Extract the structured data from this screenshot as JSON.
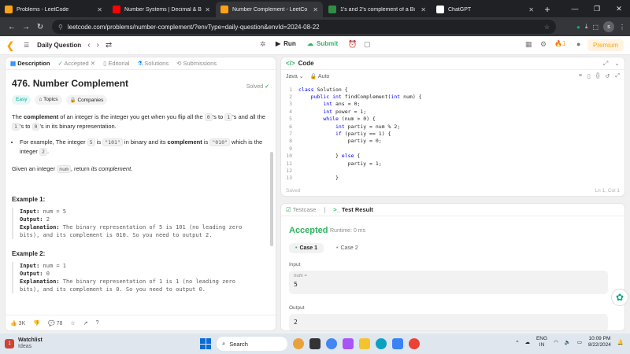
{
  "browser": {
    "tabs": [
      {
        "title": "Problems - LeetCode",
        "color": "#ffa116"
      },
      {
        "title": "Number Systems | Decimal & B",
        "color": "#ff0000"
      },
      {
        "title": "Number Complement - LeetCo",
        "color": "#ffa116",
        "active": true
      },
      {
        "title": "1's and 2's complement of a Bi",
        "color": "#2f8d46"
      },
      {
        "title": "ChatGPT",
        "color": "#ffffff"
      }
    ],
    "url": "leetcode.com/problems/number-complement/?envType=daily-question&envId=2024-08-22",
    "profile_initial": "s"
  },
  "lc_header": {
    "daily_question": "Daily Question",
    "run": "Run",
    "submit": "Submit",
    "streak": "1",
    "premium": "Premium"
  },
  "problem": {
    "tabs": {
      "description": "Description",
      "accepted": "Accepted",
      "editorial": "Editorial",
      "solutions": "Solutions",
      "submissions": "Submissions"
    },
    "title": "476. Number Complement",
    "status": "Solved",
    "difficulty": "Easy",
    "topics": "Topics",
    "companies": "Companies",
    "p1_a": "The ",
    "p1_b": "complement",
    "p1_c": " of an integer is the integer you get when you flip all the ",
    "p1_d": "0",
    "p1_e": "'s to ",
    "p1_f": "1",
    "p1_g": "'s and all the ",
    "p1_h": "1",
    "p1_i": "'s to ",
    "p1_j": "0",
    "p1_k": "'s in its binary representation.",
    "b1_a": "For example, The integer ",
    "b1_b": "5",
    "b1_c": " is ",
    "b1_d": "\"101\"",
    "b1_e": " in binary and its ",
    "b1_f": "complement",
    "b1_g": " is ",
    "b1_h": "\"010\"",
    "b1_i": " which is the integer ",
    "b1_j": "2",
    "b1_k": ".",
    "p2_a": "Given an integer ",
    "p2_b": "num",
    "p2_c": ", return ",
    "p2_d": "its complement",
    "p2_e": ".",
    "examples": [
      {
        "heading": "Example 1:",
        "input_label": "Input:",
        "input": "num = 5",
        "output_label": "Output:",
        "output": "2",
        "expl_label": "Explanation:",
        "explanation_1": "The binary representation of 5 is 101 (no leading zero",
        "explanation_2": "bits), and its complement is 010. So you need to output 2."
      },
      {
        "heading": "Example 2:",
        "input_label": "Input:",
        "input": "num = 1",
        "output_label": "Output:",
        "output": "0",
        "expl_label": "Explanation:",
        "explanation_1": "The binary representation of 1 is 1 (no leading zero",
        "explanation_2": "bits), and its complement is 0. So you need to output 0."
      }
    ],
    "likes": "3K",
    "comments": "78"
  },
  "code": {
    "title": "Code",
    "language": "Java",
    "auto": "Auto",
    "lines": [
      {
        "n": "1",
        "t": "class Solution {"
      },
      {
        "n": "2",
        "t": "    public int findComplement(int num) {"
      },
      {
        "n": "3",
        "t": "        int ans = 0;"
      },
      {
        "n": "4",
        "t": "        int power = 1;"
      },
      {
        "n": "5",
        "t": "        while (num > 0) {"
      },
      {
        "n": "6",
        "t": "            int partiy = num % 2;"
      },
      {
        "n": "7",
        "t": "            if (partiy == 1) {"
      },
      {
        "n": "8",
        "t": "                partiy = 0;"
      },
      {
        "n": "9",
        "t": ""
      },
      {
        "n": "10",
        "t": "            } else {"
      },
      {
        "n": "11",
        "t": "                partiy = 1;"
      },
      {
        "n": "12",
        "t": ""
      },
      {
        "n": "13",
        "t": "            }"
      }
    ],
    "saved": "Saved",
    "cursor": "Ln 1, Col 1"
  },
  "result": {
    "testcase_tab": "Testcase",
    "result_tab": "Test Result",
    "status": "Accepted",
    "runtime": "Runtime: 0 ms",
    "case1": "Case 1",
    "case2": "Case 2",
    "input_label": "Input",
    "param_name": "num =",
    "param_value": "5",
    "output_label": "Output",
    "output_value": "2"
  },
  "taskbar": {
    "widget_title": "Watchlist",
    "widget_sub": "Ideas",
    "widget_badge": "1",
    "search": "Search",
    "lang_1": "ENG",
    "lang_2": "IN",
    "time": "10:09 PM",
    "date": "8/22/2024"
  }
}
